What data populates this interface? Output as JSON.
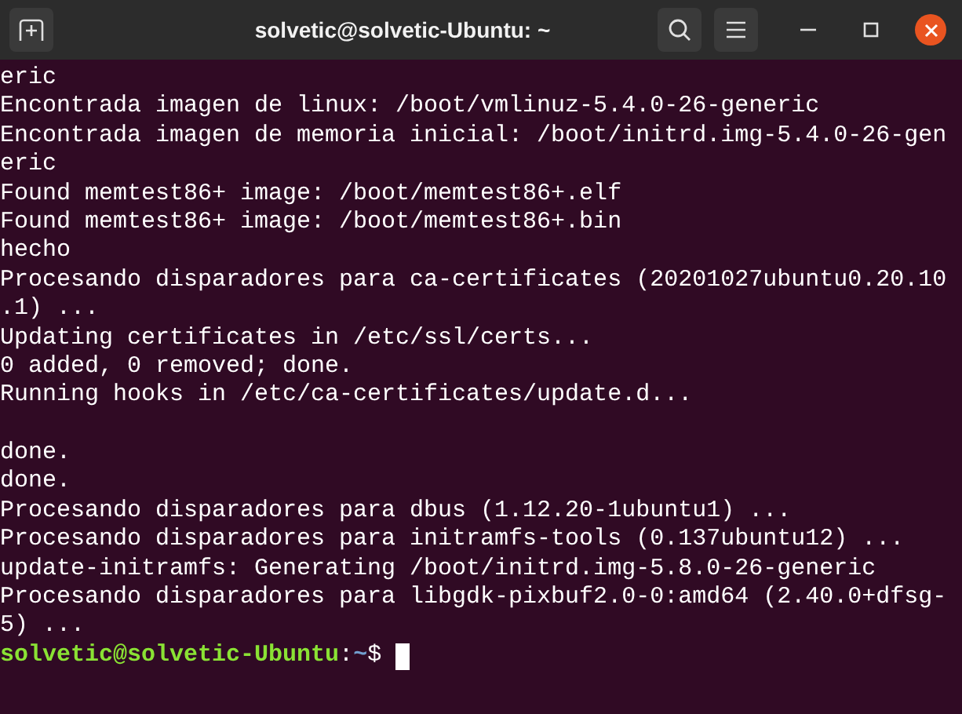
{
  "window": {
    "title": "solvetic@solvetic-Ubuntu: ~"
  },
  "terminal": {
    "lines": [
      {
        "kind": "output",
        "text": "eric"
      },
      {
        "kind": "output",
        "text": "Encontrada imagen de linux: /boot/vmlinuz-5.4.0-26-generic"
      },
      {
        "kind": "output",
        "text": "Encontrada imagen de memoria inicial: /boot/initrd.img-5.4.0-26-gen"
      },
      {
        "kind": "output",
        "text": "eric"
      },
      {
        "kind": "output",
        "text": "Found memtest86+ image: /boot/memtest86+.elf"
      },
      {
        "kind": "output",
        "text": "Found memtest86+ image: /boot/memtest86+.bin"
      },
      {
        "kind": "output",
        "text": "hecho"
      },
      {
        "kind": "output",
        "text": "Procesando disparadores para ca-certificates (20201027ubuntu0.20.10"
      },
      {
        "kind": "output",
        "text": ".1) ..."
      },
      {
        "kind": "output",
        "text": "Updating certificates in /etc/ssl/certs..."
      },
      {
        "kind": "output",
        "text": "0 added, 0 removed; done."
      },
      {
        "kind": "output",
        "text": "Running hooks in /etc/ca-certificates/update.d..."
      },
      {
        "kind": "blank"
      },
      {
        "kind": "output",
        "text": "done."
      },
      {
        "kind": "output",
        "text": "done."
      },
      {
        "kind": "output",
        "text": "Procesando disparadores para dbus (1.12.20-1ubuntu1) ..."
      },
      {
        "kind": "output",
        "text": "Procesando disparadores para initramfs-tools (0.137ubuntu12) ..."
      },
      {
        "kind": "output",
        "text": "update-initramfs: Generating /boot/initrd.img-5.8.0-26-generic"
      },
      {
        "kind": "output",
        "text": "Procesando disparadores para libgdk-pixbuf2.0-0:amd64 (2.40.0+dfsg-"
      },
      {
        "kind": "output",
        "text": "5) ..."
      },
      {
        "kind": "prompt",
        "user_host": "solvetic@solvetic-Ubuntu",
        "separator": ":",
        "path": "~",
        "symbol": "$"
      }
    ]
  }
}
